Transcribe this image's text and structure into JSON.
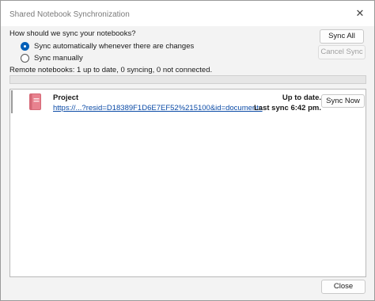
{
  "window": {
    "title": "Shared Notebook Synchronization",
    "close_glyph": "✕"
  },
  "sync_options": {
    "question": "How should we sync your notebooks?",
    "automatic_label": "Sync automatically whenever there are changes",
    "manual_label": "Sync manually",
    "selected": "automatic"
  },
  "buttons": {
    "sync_all": "Sync All",
    "cancel_sync": "Cancel Sync",
    "close": "Close"
  },
  "remote_status": "Remote notebooks: 1 up to date, 0 syncing, 0 not connected.",
  "sync_progress": 0,
  "notebooks": [
    {
      "name": "Project",
      "url": "https://...?resid=D18389F1D6E7EF52%215100&id=documents",
      "status": "Up to date.",
      "last_sync": "Last sync 6:42 pm.",
      "sync_now_label": "Sync Now",
      "icon": "notebook-icon",
      "icon_color": "#e8828f"
    }
  ],
  "colors": {
    "accent": "#005fb8",
    "link": "#0a4aa6"
  }
}
